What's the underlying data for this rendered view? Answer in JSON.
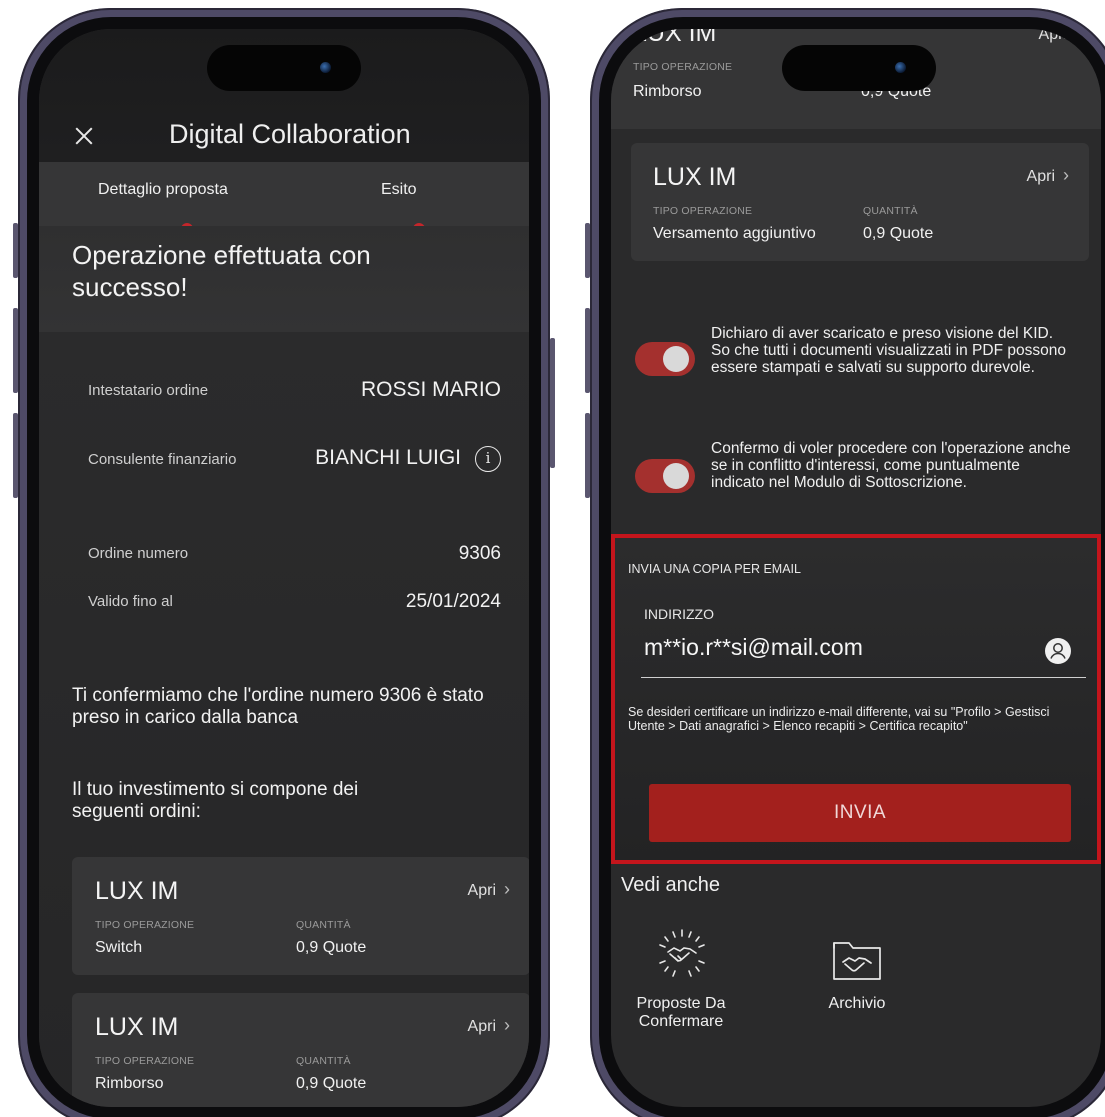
{
  "left_screen": {
    "header_title": "Digital Collaboration",
    "tabs": [
      {
        "label": "Dettaglio proposta"
      },
      {
        "label": "Esito"
      }
    ],
    "success_title": "Operazione effettuata con successo!",
    "details": [
      {
        "label": "Intestatario ordine",
        "value": "ROSSI MARIO"
      },
      {
        "label": "Consulente finanziario",
        "value": "BIANCHI LUIGI"
      },
      {
        "label": "Ordine numero",
        "value": "9306"
      },
      {
        "label": "Valido fino al",
        "value": "25/01/2024"
      }
    ],
    "confirmation_text": "Ti confermiamo che l'ordine numero 9306 è stato preso in carico dalla banca",
    "investment_text": "Il tuo investimento si compone dei seguenti ordini:",
    "orders": [
      {
        "name": "LUX IM",
        "open_label": "Apri",
        "type_label": "TIPO OPERAZIONE",
        "type_value": "Switch",
        "qty_label": "QUANTITÀ",
        "qty_value": "0,9 Quote"
      },
      {
        "name": "LUX IM",
        "open_label": "Apri",
        "type_label": "TIPO OPERAZIONE",
        "type_value": "Rimborso",
        "qty_label": "QUANTITÀ",
        "qty_value": "0,9 Quote"
      }
    ]
  },
  "right_screen": {
    "top_partial": {
      "name": "LUX IM",
      "open_label": "Apri",
      "type_label": "TIPO OPERAZIONE",
      "type_value": "Rimborso",
      "qty_value": "0,9 Quote"
    },
    "order": {
      "name": "LUX IM",
      "open_label": "Apri",
      "type_label": "TIPO OPERAZIONE",
      "type_value": "Versamento aggiuntivo",
      "qty_label": "QUANTITÀ",
      "qty_value": "0,9 Quote"
    },
    "toggles": [
      {
        "text": "Dichiaro di aver scaricato e preso visione del KID.  So che tutti i documenti visualizzati in PDF possono essere stampati e salvati su supporto durevole.",
        "on": true
      },
      {
        "text": "Confermo di voler procedere con l'operazione anche se in conflitto d'interessi, come puntualmente indicato nel Modulo di Sottoscrizione.",
        "on": true
      }
    ],
    "email": {
      "section_title": "INVIA UNA COPIA PER EMAIL",
      "address_label": "INDIRIZZO",
      "address_value": "m**io.r**si@mail.com",
      "note": "Se desideri certificare un indirizzo e-mail differente, vai su \"Profilo > Gestisci Utente > Dati anagrafici > Elenco recapiti > Certifica recapito\"",
      "send_label": "INVIA",
      "highlight_color": "#c4151c"
    },
    "see_also": {
      "title": "Vedi anche",
      "items": [
        {
          "label": "Proposte Da Confermare",
          "icon": "handshake-burst-icon"
        },
        {
          "label": "Archivio",
          "icon": "handshake-folder-icon"
        }
      ]
    }
  },
  "colors": {
    "accent_red": "#b31f24",
    "button_red": "#a3201d",
    "toggle_red": "#a4302e",
    "card_bg": "#363637"
  }
}
